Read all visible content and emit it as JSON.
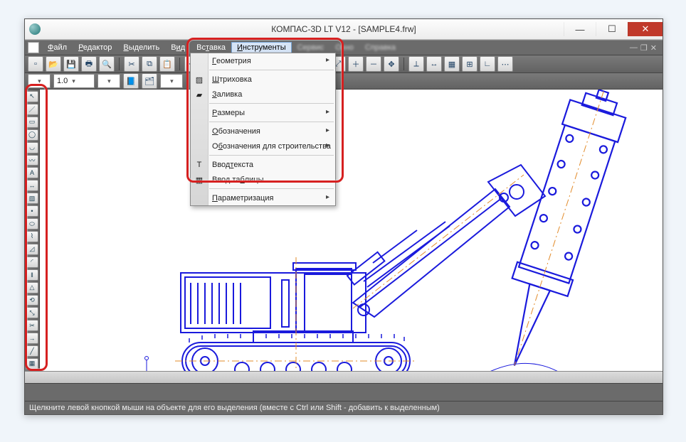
{
  "title": "КОМПАС-3D LT V12 - [SAMPLE4.frw]",
  "menu": {
    "items": [
      {
        "label": "Файл",
        "u": "Ф"
      },
      {
        "label": "Редактор",
        "u": "Р"
      },
      {
        "label": "Выделить",
        "u": "В"
      },
      {
        "label": "Вид",
        "u": "и"
      },
      {
        "label": "Вставка",
        "u": "т"
      },
      {
        "label": "Инструменты",
        "u": "И",
        "highlight": true
      },
      {
        "label": "Сервис",
        "u": "С",
        "dim": true
      },
      {
        "label": "Окно",
        "u": "О",
        "dim": true
      },
      {
        "label": "Справка",
        "u": "п",
        "dim": true
      }
    ]
  },
  "zoom": "1.0",
  "dropdown": {
    "items": [
      {
        "label": "Геометрия",
        "u": "Г",
        "sub": true
      },
      {
        "sep": true
      },
      {
        "label": "Штриховка",
        "u": "Ш",
        "icon": "hatch"
      },
      {
        "label": "Заливка",
        "u": "З",
        "icon": "fill"
      },
      {
        "sep": true
      },
      {
        "label": "Размеры",
        "u": "Р",
        "sub": true
      },
      {
        "sep": true
      },
      {
        "label": "Обозначения",
        "u": "О",
        "sub": true
      },
      {
        "label": "Обозначения для строительства",
        "u": "б",
        "sub": true
      },
      {
        "sep": true
      },
      {
        "label": "Ввод текста",
        "u": "т",
        "icon": "text"
      },
      {
        "label": "Ввод таблицы",
        "u": "б",
        "icon": "table"
      },
      {
        "sep": true
      },
      {
        "label": "Параметризация",
        "u": "П",
        "sub": true
      }
    ]
  },
  "status": "Щелкните левой кнопкой мыши на объекте для его выделения (вместе с Ctrl или Shift - добавить к выделенным)"
}
